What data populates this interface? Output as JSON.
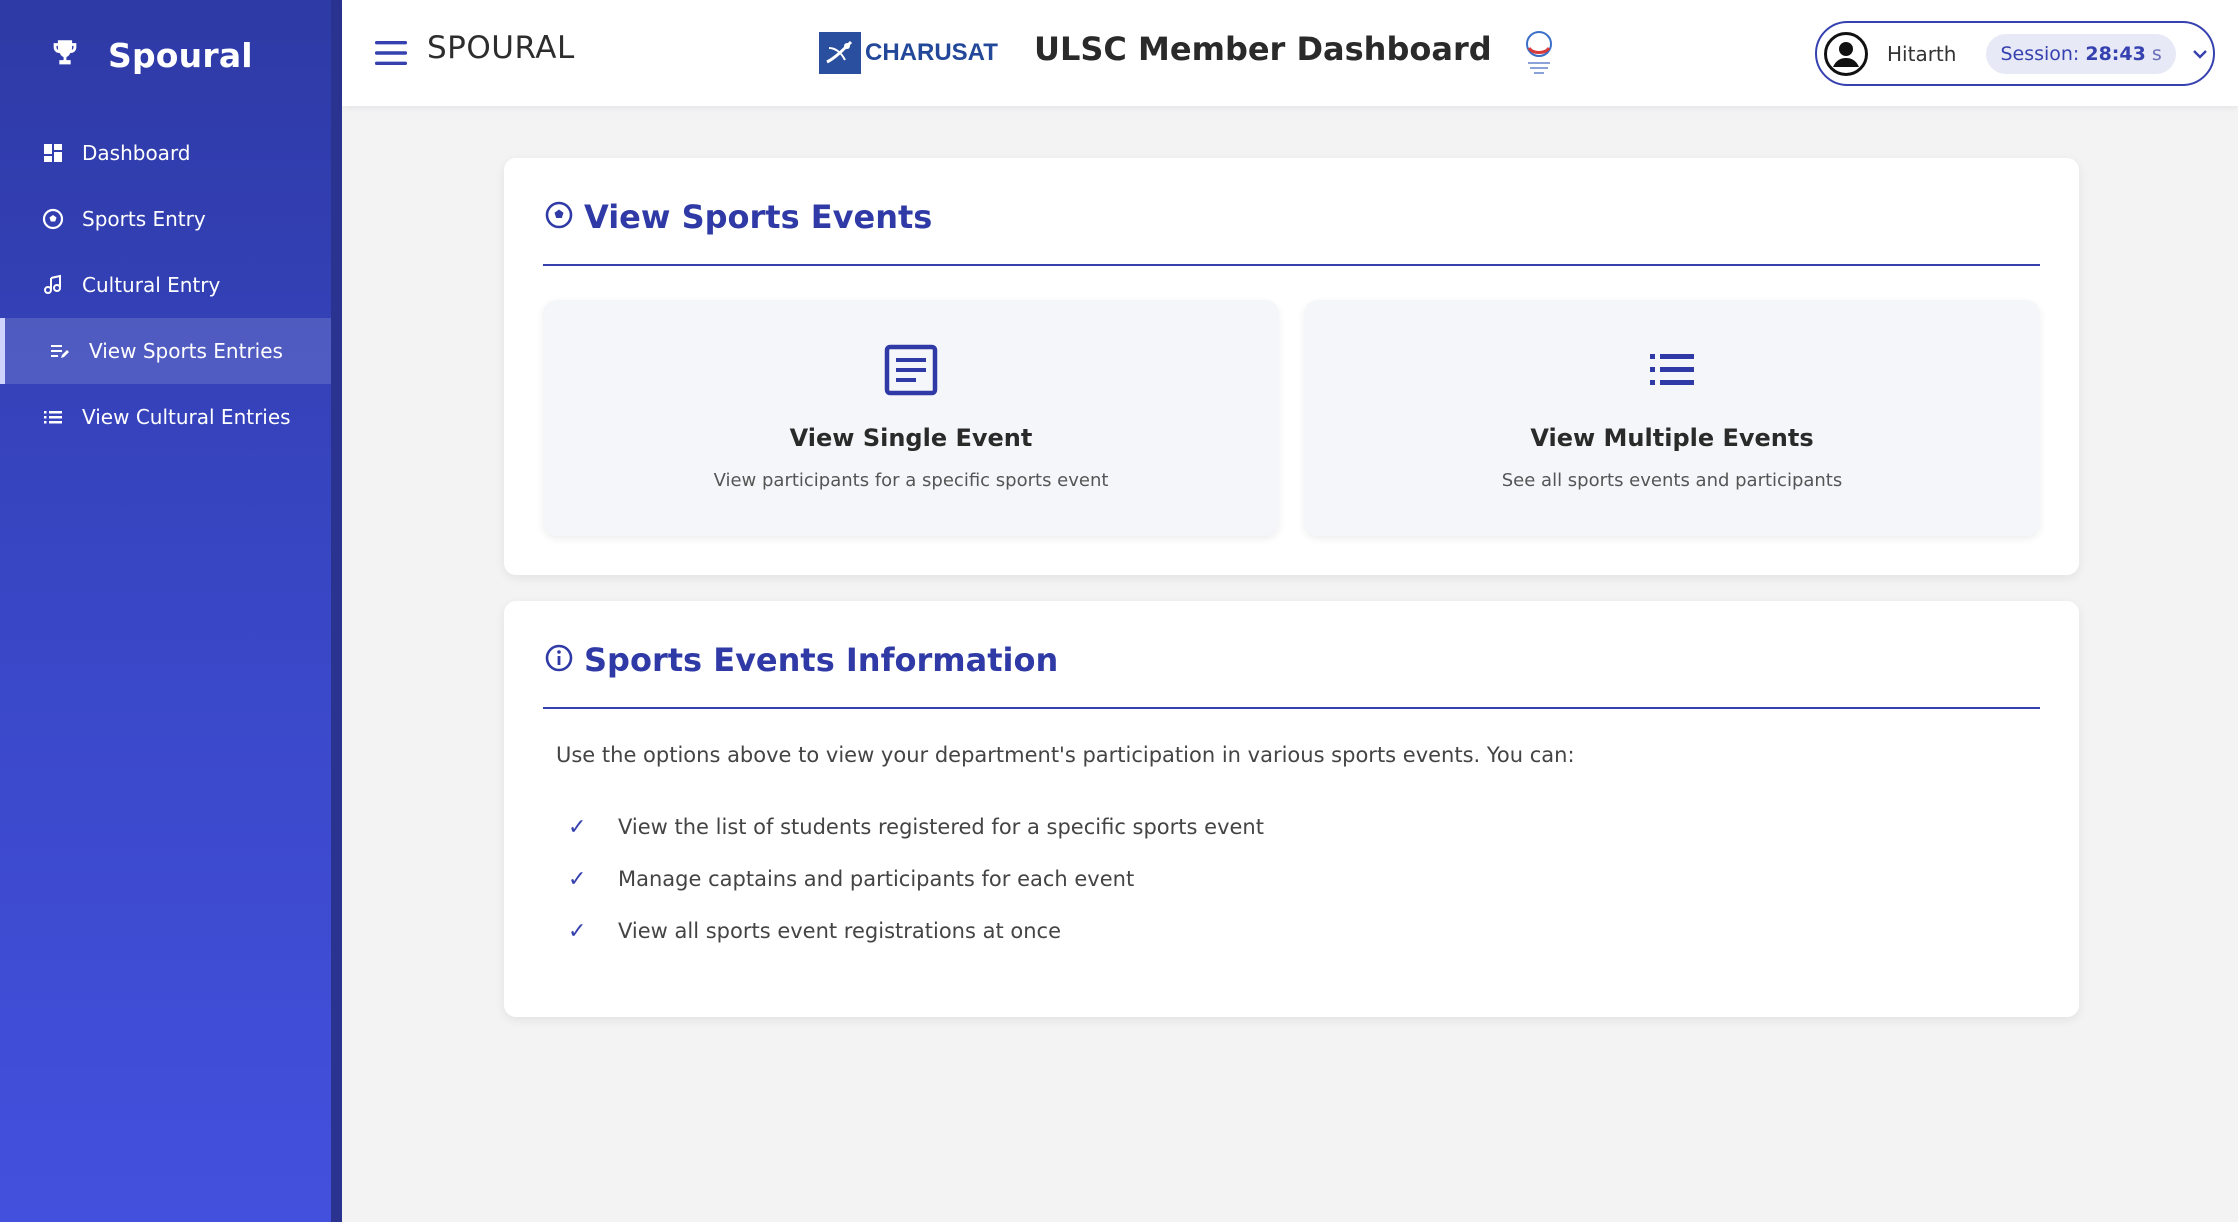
{
  "sidebar": {
    "brand": "Spoural",
    "items": [
      {
        "label": "Dashboard",
        "icon": "dashboard-icon"
      },
      {
        "label": "Sports Entry",
        "icon": "soccer-ball-icon"
      },
      {
        "label": "Cultural Entry",
        "icon": "music-note-icon"
      },
      {
        "label": "View Sports Entries",
        "icon": "list-edit-icon",
        "active": true
      },
      {
        "label": "View Cultural Entries",
        "icon": "list-icon"
      }
    ]
  },
  "header": {
    "app_title": "SPOURAL",
    "charusat_label": "CHARUSAT",
    "dashboard_title": "ULSC Member Dashboard",
    "user_name": "Hitarth",
    "session_label": "Session:",
    "session_time": "28:43",
    "session_unit": "s"
  },
  "view_events": {
    "title": "View Sports Events",
    "options": [
      {
        "title": "View Single Event",
        "description": "View participants for a specific sports event"
      },
      {
        "title": "View Multiple Events",
        "description": "See all sports events and participants"
      }
    ]
  },
  "info": {
    "title": "Sports Events Information",
    "intro": "Use the options above to view your department's participation in various sports events. You can:",
    "points": [
      "View the list of students registered for a specific sports event",
      "Manage captains and participants for each event",
      "View all sports event registrations at once"
    ]
  },
  "colors": {
    "primary": "#3641b0",
    "sidebar_top": "#2e3aa5",
    "sidebar_bottom": "#4350dd"
  }
}
